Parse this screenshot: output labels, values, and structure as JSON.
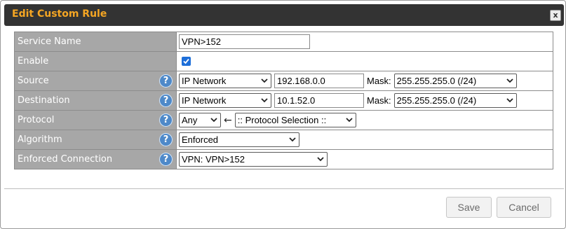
{
  "dialog": {
    "title": "Edit Custom Rule",
    "close_label": "x"
  },
  "help_glyph": "?",
  "fields": {
    "service_name": {
      "label": "Service Name",
      "value": "VPN>152"
    },
    "enable": {
      "label": "Enable",
      "checked": true
    },
    "source": {
      "label": "Source",
      "type": "IP Network",
      "ip": "192.168.0.0",
      "mask_label": "Mask:",
      "mask": "255.255.255.0 (/24)"
    },
    "destination": {
      "label": "Destination",
      "type": "IP Network",
      "ip": "10.1.52.0",
      "mask_label": "Mask:",
      "mask": "255.255.255.0 (/24)"
    },
    "protocol": {
      "label": "Protocol",
      "value": "Any",
      "arrow": "←",
      "selection": ":: Protocol Selection ::"
    },
    "algorithm": {
      "label": "Algorithm",
      "value": "Enforced"
    },
    "enforced_connection": {
      "label": "Enforced Connection",
      "value": "VPN: VPN>152"
    }
  },
  "buttons": {
    "save": "Save",
    "cancel": "Cancel"
  },
  "colors": {
    "title_bar": "#333333",
    "title_text": "#f5a623",
    "label_bg": "#a7a7a7",
    "help_icon": "#4e89c9",
    "checkbox": "#1e6fd9"
  }
}
